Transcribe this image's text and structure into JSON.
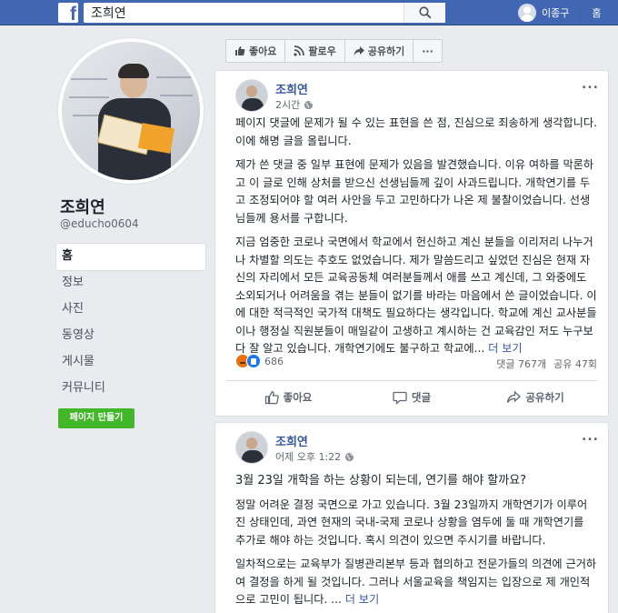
{
  "topbar": {
    "logo_letter": "f",
    "search_value": "조희연",
    "user_name": "이종구",
    "home_label": "홈"
  },
  "page": {
    "name": "조희연",
    "handle": "@educho0604",
    "nav": [
      "홈",
      "정보",
      "사진",
      "동영상",
      "게시물",
      "커뮤니티"
    ],
    "create_page_label": "페이지 만들기"
  },
  "actionbar": {
    "like": "좋아요",
    "follow": "팔로우",
    "share": "공유하기",
    "more": "···"
  },
  "posts": [
    {
      "author": "조희연",
      "time": "2시간",
      "paragraphs": [
        "페이지 댓글에 문제가 될 수 있는 표현을 쓴 점, 진심으로 죄송하게 생각합니다. 이에 해명 글을 올립니다.",
        "제가 쓴 댓글 중 일부 표현에 문제가 있음을 발견했습니다. 이유 여하를 막론하고 이 글로 인해 상처를 받으신 선생님들께 깊이 사과드립니다. 개학연기를 두고 조정되어야 할 여러 사안을 두고 고민하다가 나온 제 불찰이었습니다. 선생님들께 용서를 구합니다.",
        "지금 엄중한 코로나 국면에서 학교에서 헌신하고 계신 분들을 이리저리 나누거나 차별할 의도는 추호도 없었습니다. 제가 말씀드리고 싶었던 진심은 현재 자신의 자리에서 모든 교육공동체 여러분들께서 애를 쓰고 계신데, 그 와중에도 소외되거나 어려움을 겪는 분들이 없기를 바라는 마음에서 쓴 글이었습니다. 이에 대한 적극적인 국가적 대책도 필요하다는 생각입니다. 학교에 계신 교사분들이나 행정실 직원분들이 매일같이 고생하고 계시하는 건 교육감인 저도 누구보다 잘 알고 있습니다. 개학연기에도 불구하고 학교에..."
      ],
      "see_more": "더 보기",
      "reaction_count": "686",
      "comments": "댓글 767개",
      "shares": "공유 47회",
      "actions": {
        "like": "좋아요",
        "comment": "댓글",
        "share": "공유하기"
      }
    },
    {
      "author": "조희연",
      "time": "어제 오후 1:22",
      "paragraphs": [
        "3월 23일 개학을 하는 상황이 되는데, 연기를 해야 할까요?",
        "정말 어려운 결정 국면으로 가고 있습니다. 3월 23일까지 개학연기가 이루어진 상태인데, 과연 현재의 국내-국제 코로나 상황을 염두에 둘 때 개학연기를 추가로 해야 하는 것입니다. 혹시 의견이 있으면 주시기를 바랍니다.",
        "일차적으로는 교육부가 질병관리본부 등과 협의하고 전문가들의 의견에 근거하여 결정을 하게 될 것입니다. 그러나 서울교육을 책임지는 입장으로 제 개인적으로 고민이 됩니다. ..."
      ],
      "see_more": "더 보기"
    }
  ],
  "colors": {
    "fb_blue": "#4267b2",
    "link_blue": "#385898",
    "green": "#42b72a",
    "background": "#e9ebee"
  }
}
